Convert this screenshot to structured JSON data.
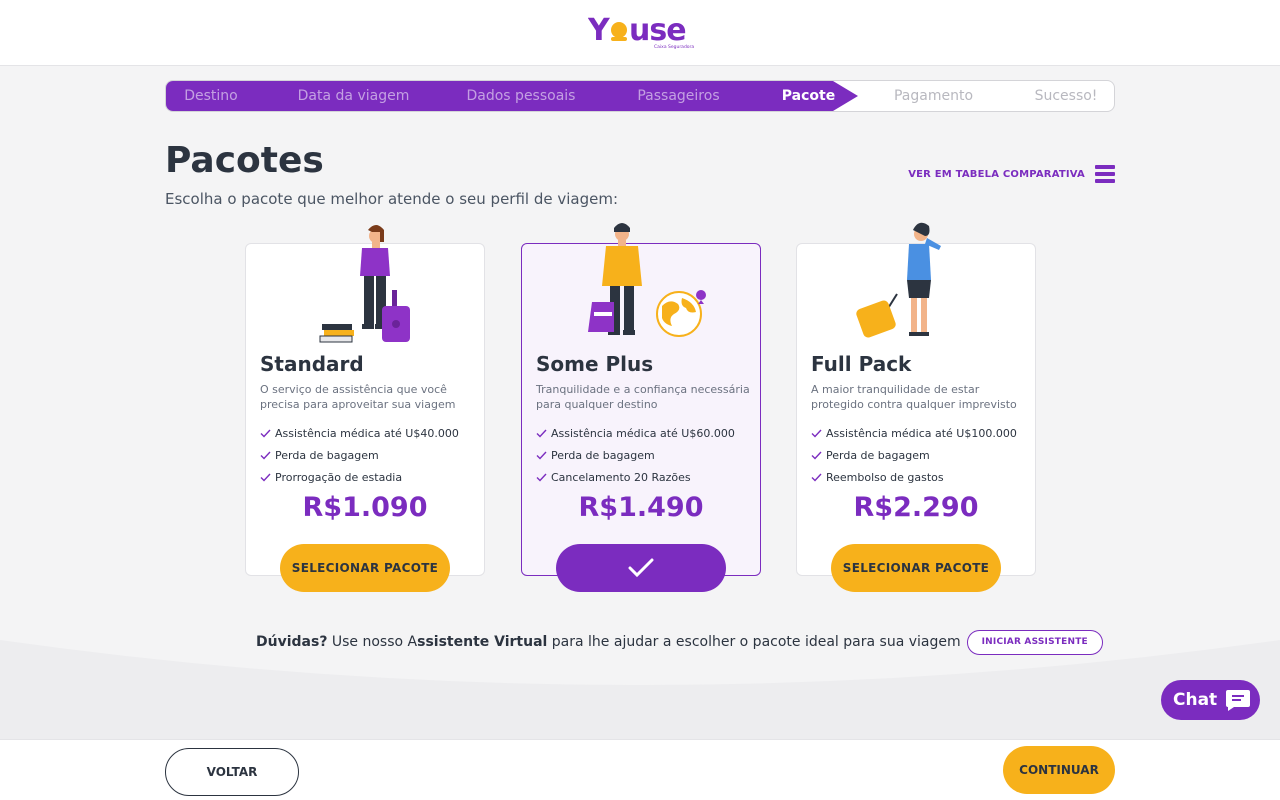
{
  "brand": {
    "name": "YOUSE",
    "tagline": "Caixa Seguradora",
    "colors": {
      "primary": "#7b2cbf",
      "accent": "#f7b11b",
      "text": "#2c3440"
    }
  },
  "stepper": {
    "current_index": 4,
    "steps": [
      {
        "label": "Destino",
        "status": "done"
      },
      {
        "label": "Data da viagem",
        "status": "done"
      },
      {
        "label": "Dados pessoais",
        "status": "done"
      },
      {
        "label": "Passageiros",
        "status": "done"
      },
      {
        "label": "Pacote",
        "status": "current"
      },
      {
        "label": "Pagamento",
        "status": "todo"
      },
      {
        "label": "Sucesso!",
        "status": "todo"
      }
    ]
  },
  "page": {
    "title": "Pacotes",
    "subtitle": "Escolha o pacote que melhor atende o seu perfil de viagem:",
    "compare_label": "VER EM TABELA COMPARATIVA",
    "compare_icon": "menu-icon"
  },
  "plans": [
    {
      "name": "Standard",
      "description": "O serviço de assistência que você precisa para aproveitar sua viagem",
      "features": [
        "Assistência médica até U$40.000",
        "Perda de bagagem",
        "Prorrogação de estadia"
      ],
      "price": "R$1.090",
      "button_label": "SELECIONAR PACOTE",
      "selected": false,
      "illustration": "woman-with-suitcase-and-books"
    },
    {
      "name": "Some Plus",
      "description": "Tranquilidade e a confiança necessária para qualquer destino",
      "features": [
        "Assistência médica até U$60.000",
        "Perda de bagagem",
        "Cancelamento 20 Razões"
      ],
      "price": "R$1.490",
      "button_label": "",
      "selected": true,
      "illustration": "man-with-backpack-and-globe"
    },
    {
      "name": "Full Pack",
      "description": "A maior tranquilidade de estar protegido contra qualquer imprevisto",
      "features": [
        "Assistência médica até U$100.000",
        "Perda de bagagem",
        "Reembolso de gastos"
      ],
      "price": "R$2.290",
      "button_label": "SELECIONAR PACOTE",
      "selected": false,
      "illustration": "businesswoman-with-suitcase"
    }
  ],
  "help": {
    "question": "Dúvidas?",
    "text_before": " Use nosso A",
    "highlight": "ssistente Virtual",
    "text_after": " para lhe ajudar a escolher o pacote ideal para sua viagem",
    "button_label": "INICIAR ASSISTENTE"
  },
  "chat": {
    "label": "Chat",
    "icon": "chat-bubble-icon"
  },
  "footer": {
    "back_label": "VOLTAR",
    "continue_label": "CONTINUAR"
  }
}
